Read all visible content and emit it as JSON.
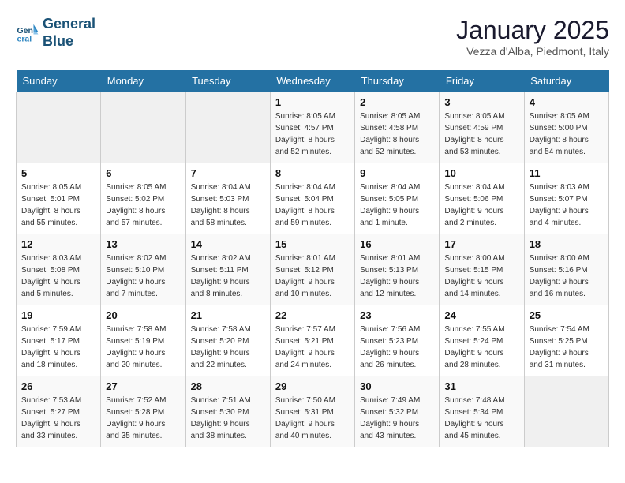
{
  "logo": {
    "line1": "General",
    "line2": "Blue"
  },
  "calendar": {
    "title": "January 2025",
    "subtitle": "Vezza d'Alba, Piedmont, Italy"
  },
  "headers": [
    "Sunday",
    "Monday",
    "Tuesday",
    "Wednesday",
    "Thursday",
    "Friday",
    "Saturday"
  ],
  "weeks": [
    [
      {
        "day": "",
        "info": ""
      },
      {
        "day": "",
        "info": ""
      },
      {
        "day": "",
        "info": ""
      },
      {
        "day": "1",
        "info": "Sunrise: 8:05 AM\nSunset: 4:57 PM\nDaylight: 8 hours\nand 52 minutes."
      },
      {
        "day": "2",
        "info": "Sunrise: 8:05 AM\nSunset: 4:58 PM\nDaylight: 8 hours\nand 52 minutes."
      },
      {
        "day": "3",
        "info": "Sunrise: 8:05 AM\nSunset: 4:59 PM\nDaylight: 8 hours\nand 53 minutes."
      },
      {
        "day": "4",
        "info": "Sunrise: 8:05 AM\nSunset: 5:00 PM\nDaylight: 8 hours\nand 54 minutes."
      }
    ],
    [
      {
        "day": "5",
        "info": "Sunrise: 8:05 AM\nSunset: 5:01 PM\nDaylight: 8 hours\nand 55 minutes."
      },
      {
        "day": "6",
        "info": "Sunrise: 8:05 AM\nSunset: 5:02 PM\nDaylight: 8 hours\nand 57 minutes."
      },
      {
        "day": "7",
        "info": "Sunrise: 8:04 AM\nSunset: 5:03 PM\nDaylight: 8 hours\nand 58 minutes."
      },
      {
        "day": "8",
        "info": "Sunrise: 8:04 AM\nSunset: 5:04 PM\nDaylight: 8 hours\nand 59 minutes."
      },
      {
        "day": "9",
        "info": "Sunrise: 8:04 AM\nSunset: 5:05 PM\nDaylight: 9 hours\nand 1 minute."
      },
      {
        "day": "10",
        "info": "Sunrise: 8:04 AM\nSunset: 5:06 PM\nDaylight: 9 hours\nand 2 minutes."
      },
      {
        "day": "11",
        "info": "Sunrise: 8:03 AM\nSunset: 5:07 PM\nDaylight: 9 hours\nand 4 minutes."
      }
    ],
    [
      {
        "day": "12",
        "info": "Sunrise: 8:03 AM\nSunset: 5:08 PM\nDaylight: 9 hours\nand 5 minutes."
      },
      {
        "day": "13",
        "info": "Sunrise: 8:02 AM\nSunset: 5:10 PM\nDaylight: 9 hours\nand 7 minutes."
      },
      {
        "day": "14",
        "info": "Sunrise: 8:02 AM\nSunset: 5:11 PM\nDaylight: 9 hours\nand 8 minutes."
      },
      {
        "day": "15",
        "info": "Sunrise: 8:01 AM\nSunset: 5:12 PM\nDaylight: 9 hours\nand 10 minutes."
      },
      {
        "day": "16",
        "info": "Sunrise: 8:01 AM\nSunset: 5:13 PM\nDaylight: 9 hours\nand 12 minutes."
      },
      {
        "day": "17",
        "info": "Sunrise: 8:00 AM\nSunset: 5:15 PM\nDaylight: 9 hours\nand 14 minutes."
      },
      {
        "day": "18",
        "info": "Sunrise: 8:00 AM\nSunset: 5:16 PM\nDaylight: 9 hours\nand 16 minutes."
      }
    ],
    [
      {
        "day": "19",
        "info": "Sunrise: 7:59 AM\nSunset: 5:17 PM\nDaylight: 9 hours\nand 18 minutes."
      },
      {
        "day": "20",
        "info": "Sunrise: 7:58 AM\nSunset: 5:19 PM\nDaylight: 9 hours\nand 20 minutes."
      },
      {
        "day": "21",
        "info": "Sunrise: 7:58 AM\nSunset: 5:20 PM\nDaylight: 9 hours\nand 22 minutes."
      },
      {
        "day": "22",
        "info": "Sunrise: 7:57 AM\nSunset: 5:21 PM\nDaylight: 9 hours\nand 24 minutes."
      },
      {
        "day": "23",
        "info": "Sunrise: 7:56 AM\nSunset: 5:23 PM\nDaylight: 9 hours\nand 26 minutes."
      },
      {
        "day": "24",
        "info": "Sunrise: 7:55 AM\nSunset: 5:24 PM\nDaylight: 9 hours\nand 28 minutes."
      },
      {
        "day": "25",
        "info": "Sunrise: 7:54 AM\nSunset: 5:25 PM\nDaylight: 9 hours\nand 31 minutes."
      }
    ],
    [
      {
        "day": "26",
        "info": "Sunrise: 7:53 AM\nSunset: 5:27 PM\nDaylight: 9 hours\nand 33 minutes."
      },
      {
        "day": "27",
        "info": "Sunrise: 7:52 AM\nSunset: 5:28 PM\nDaylight: 9 hours\nand 35 minutes."
      },
      {
        "day": "28",
        "info": "Sunrise: 7:51 AM\nSunset: 5:30 PM\nDaylight: 9 hours\nand 38 minutes."
      },
      {
        "day": "29",
        "info": "Sunrise: 7:50 AM\nSunset: 5:31 PM\nDaylight: 9 hours\nand 40 minutes."
      },
      {
        "day": "30",
        "info": "Sunrise: 7:49 AM\nSunset: 5:32 PM\nDaylight: 9 hours\nand 43 minutes."
      },
      {
        "day": "31",
        "info": "Sunrise: 7:48 AM\nSunset: 5:34 PM\nDaylight: 9 hours\nand 45 minutes."
      },
      {
        "day": "",
        "info": ""
      }
    ]
  ]
}
